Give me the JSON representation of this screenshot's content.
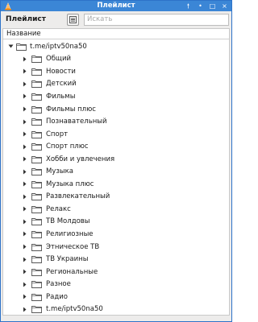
{
  "window": {
    "title": "Плейлист",
    "controls": {
      "pin": "🠕",
      "minimize": "•",
      "maximize": "□",
      "close": "×"
    }
  },
  "toolbar": {
    "title": "Плейлист",
    "search_placeholder": "Искать"
  },
  "tree": {
    "column_header": "Название",
    "root_label": "t.me/iptv50na50",
    "items": [
      {
        "label": "Общий"
      },
      {
        "label": "Новости"
      },
      {
        "label": "Детский"
      },
      {
        "label": "Фильмы"
      },
      {
        "label": "Фильмы плюс"
      },
      {
        "label": "Познавательный"
      },
      {
        "label": "Спорт"
      },
      {
        "label": "Спорт плюс"
      },
      {
        "label": "Хобби и увлечения"
      },
      {
        "label": "Музыка"
      },
      {
        "label": "Музыка плюс"
      },
      {
        "label": "Развлекательный"
      },
      {
        "label": "Релакс"
      },
      {
        "label": "ТВ Молдовы"
      },
      {
        "label": "Религиозные"
      },
      {
        "label": "Этническое ТВ"
      },
      {
        "label": "ТВ Украины"
      },
      {
        "label": "Региональные"
      },
      {
        "label": "Разное"
      },
      {
        "label": "Радио"
      },
      {
        "label": "t.me/iptv50na50"
      }
    ]
  }
}
